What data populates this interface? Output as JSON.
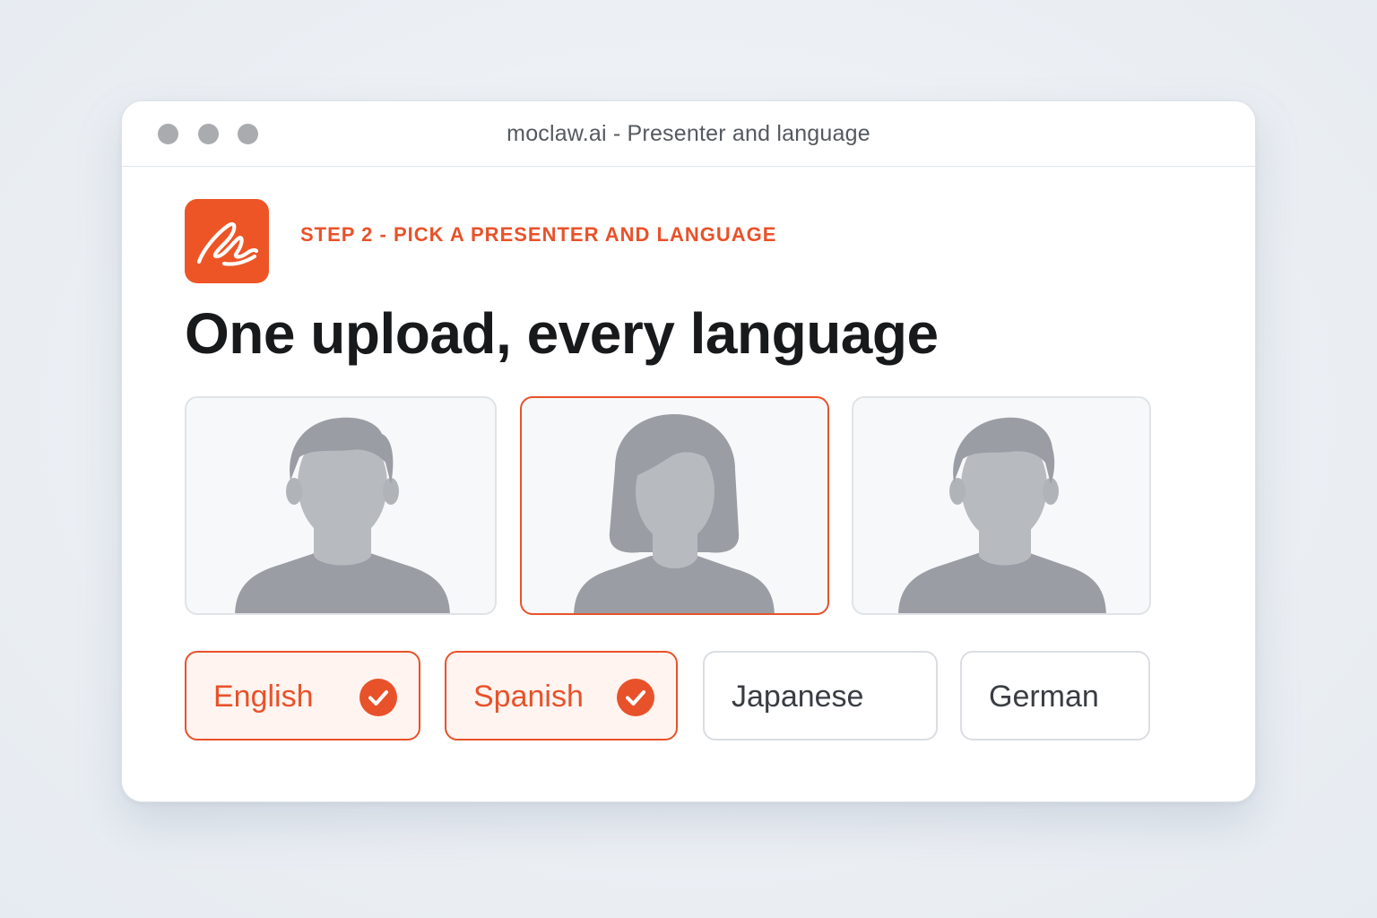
{
  "window": {
    "title": "moclaw.ai - Presenter and language"
  },
  "brand": {
    "logo_icon": "signature-icon",
    "accent_color": "#e8522a"
  },
  "step": {
    "label": "STEP 2 - PICK A PRESENTER AND LANGUAGE"
  },
  "headline": "One upload, every language",
  "presenters": [
    {
      "avatar": "male-avatar-icon",
      "selected": false
    },
    {
      "avatar": "female-avatar-icon",
      "selected": true
    },
    {
      "avatar": "male-avatar-icon",
      "selected": false
    }
  ],
  "languages": [
    {
      "label": "English",
      "selected": true,
      "icon": "checkmark-icon"
    },
    {
      "label": "Spanish",
      "selected": true,
      "icon": "checkmark-icon"
    },
    {
      "label": "Japanese",
      "selected": false
    },
    {
      "label": "German",
      "selected": false
    }
  ]
}
